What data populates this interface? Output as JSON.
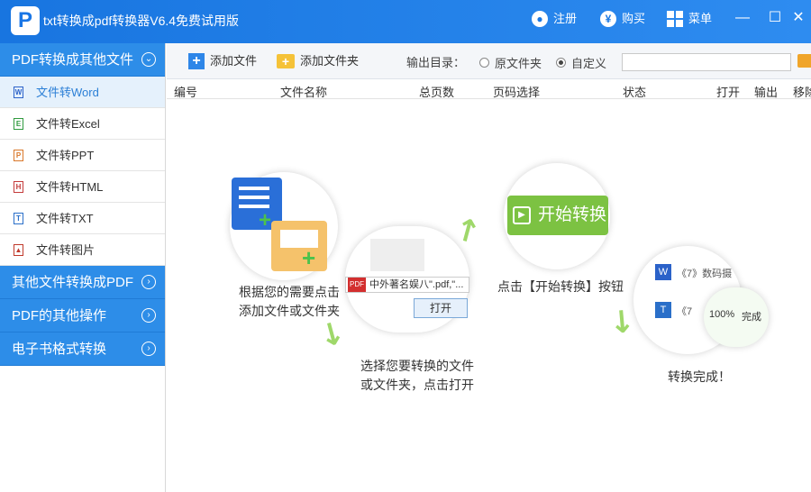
{
  "app": {
    "logo": "P",
    "title": "txt转换成pdf转换器V6.4免费试用版"
  },
  "titlebar": {
    "register": "注册",
    "buy": "购买",
    "menu": "菜单",
    "register_icon": "user-icon",
    "buy_icon": "yen-icon",
    "menu_icon": "grid-icon"
  },
  "window": {
    "minimize": "—",
    "maximize": "☐",
    "close": "✕"
  },
  "sidebar": {
    "section1": "PDF转换成其他文件",
    "items": [
      {
        "label": "文件转Word",
        "icon": "W",
        "color": "#2b62c9"
      },
      {
        "label": "文件转Excel",
        "icon": "E",
        "color": "#2f9a3e"
      },
      {
        "label": "文件转PPT",
        "icon": "P",
        "color": "#d9782a"
      },
      {
        "label": "文件转HTML",
        "icon": "H",
        "color": "#c43b3b"
      },
      {
        "label": "文件转TXT",
        "icon": "T",
        "color": "#2a6fc9"
      },
      {
        "label": "文件转图片",
        "icon": "▲",
        "color": "#c0392b"
      }
    ],
    "section2": "其他文件转换成PDF",
    "section3": "PDF的其他操作",
    "section4": "电子书格式转换"
  },
  "toolbar": {
    "add_file": "添加文件",
    "add_folder": "添加文件夹",
    "output_label": "输出目录：",
    "opt_original": "原文件夹",
    "opt_custom": "自定义",
    "custom_selected": true,
    "path": ""
  },
  "table": {
    "headers": [
      "编号",
      "文件名称",
      "总页数",
      "页码选择",
      "状态",
      "打开",
      "输出",
      "移除"
    ]
  },
  "guide": {
    "step1": "根据您的需要点击\n添加文件或文件夹",
    "step2": "选择您要转换的文件\n或文件夹，点击打开",
    "step3": "点击【开始转换】按钮",
    "step4": "转换完成！",
    "dialog_filename": "中外著名娱八\".pdf,\"...",
    "dialog_pdf_tag": "PDF",
    "dialog_open": "打开",
    "start_button": "开始转换",
    "done_file1": "《7》数码摄",
    "done_file2": "《7",
    "done_progress": "100%",
    "done_status": "完成"
  }
}
